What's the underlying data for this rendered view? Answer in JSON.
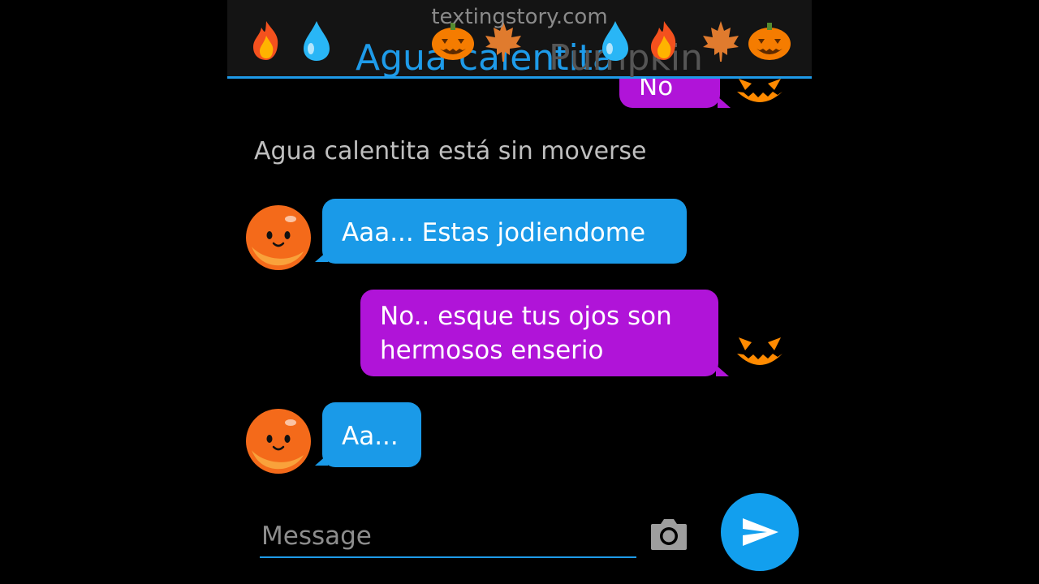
{
  "header": {
    "title_left": "Agua calentita",
    "title_right": "Pumpkin",
    "watermark": "textingstory.com",
    "left_emojis": [
      "fire-icon",
      "droplet-icon",
      "jack-o-lantern-icon",
      "maple-leaf-icon"
    ],
    "right_emojis": [
      "droplet-icon",
      "fire-icon",
      "maple-leaf-icon",
      "jack-o-lantern-icon"
    ],
    "accent_color": "#1e9be9"
  },
  "messages": {
    "partial_top": "No",
    "status_text": "Agua calentita está sin moverse",
    "m1": "Aaa... Estas jodiendome",
    "m2_line1": "No.. esque tus ojos son",
    "m2_line2": "hermosos enserio",
    "m3": "Aa..."
  },
  "colors": {
    "incoming_bubble": "#1a9ae8",
    "outgoing_bubble": "#b014d8",
    "background": "#000000"
  },
  "composer": {
    "placeholder": "Message",
    "camera_icon": "camera-icon",
    "send_icon": "send-icon"
  }
}
